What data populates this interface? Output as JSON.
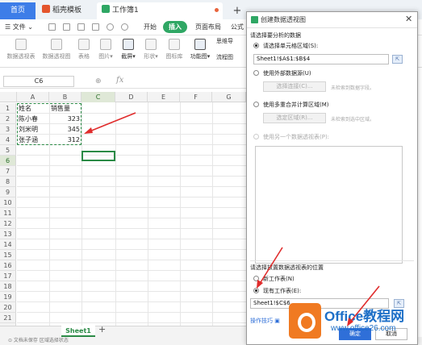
{
  "tabs": {
    "home": "首页",
    "template": "稻壳模板",
    "workbook": "工作簿1",
    "add": "+"
  },
  "menu": {
    "file": "☰ 文件 ⌄",
    "start": "开始",
    "insert": "插入",
    "layout": "页面布局",
    "formula": "公式"
  },
  "ribbon": {
    "items": [
      "数据透视表",
      "数据透视图",
      "表格",
      "图片▾",
      "截屏▾",
      "形状▾",
      "图标库",
      "功能图▾"
    ],
    "right1": "思维导",
    "right2": "流程图"
  },
  "formula": {
    "namebox": "C6",
    "zoom": "⊕",
    "fx": "fx"
  },
  "grid": {
    "columns": [
      "A",
      "B",
      "C",
      "D",
      "E",
      "F",
      "G"
    ],
    "rows": [
      "1",
      "2",
      "3",
      "4",
      "5",
      "6",
      "7",
      "8",
      "9",
      "10",
      "11",
      "12",
      "13",
      "14",
      "15",
      "16",
      "17",
      "18",
      "19",
      "20",
      "21",
      "22"
    ],
    "data": [
      [
        "姓名",
        "销售量"
      ],
      [
        "陈小春",
        "323"
      ],
      [
        "刘米明",
        "345"
      ],
      [
        "张子涵",
        "312"
      ]
    ]
  },
  "sheets": {
    "active": "Sheet1",
    "add": "+"
  },
  "status": {
    "left": "⊙ 文档未保存   区域选择状态"
  },
  "dialog": {
    "title": "创建数据透视图",
    "section1": "请选择要分析的数据",
    "opt_range": "请选择单元格区域(S):",
    "range_value": "Sheet1!$A$1:$B$4",
    "opt_external": "使用外部数据源(U)",
    "btn_choose_conn": "选择连接(C)...",
    "hint_no_field": "未检索到数据字段。",
    "opt_multi": "使用多重合并计算区域(M)",
    "btn_choose_area": "选定区域(R)...",
    "hint_no_area": "未检索到选中区域。",
    "opt_other": "使用另一个数据透视表(P):",
    "section2": "请选择放置数据透视表的位置",
    "opt_new": "新工作表(N)",
    "opt_existing": "现有工作表(E):",
    "dest_value": "Sheet1!$C$6",
    "tips": "操作技巧",
    "ok": "确定",
    "cancel": "取消"
  },
  "watermark": {
    "brand": "Office教程网",
    "url": "www.office26.com"
  }
}
